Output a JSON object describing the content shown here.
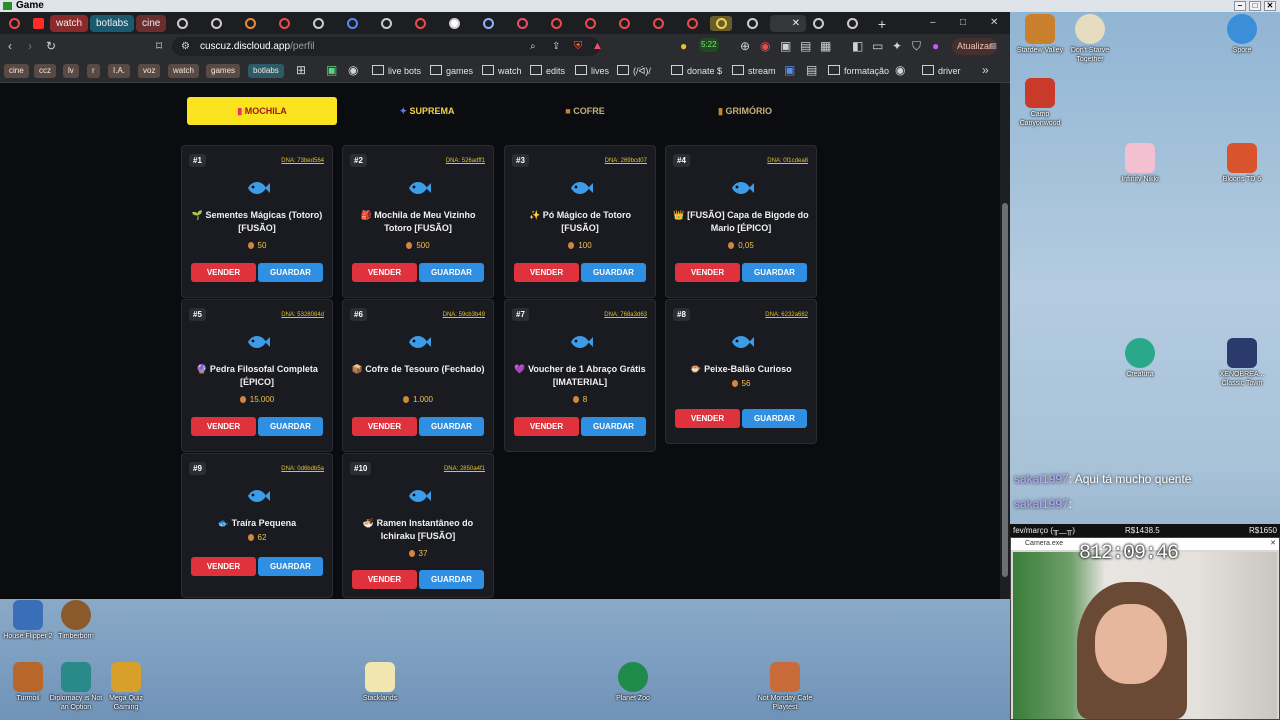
{
  "window": {
    "title": "Game"
  },
  "tabs": {
    "pinned": [
      "watch",
      "botlabs",
      "cine"
    ],
    "update_label": "Atualizar",
    "close_symbol": "✕",
    "new_tab_symbol": "+"
  },
  "address": {
    "host": "cuscuz.discloud.app",
    "path": "/perfil",
    "counter": "5:22"
  },
  "bookmarks": {
    "tags": [
      "cine",
      "ccz",
      "lv",
      "r",
      "I.A.",
      "voz",
      "watch",
      "games",
      "botlabs"
    ],
    "folders": [
      "live bots",
      "games",
      "watch",
      "edits",
      "lives",
      "(/ᐛ)/",
      "donate $",
      "stream",
      "formatação",
      "driver"
    ],
    "more": "»"
  },
  "inventory": {
    "tabs": [
      {
        "label": "MOCHILA",
        "icon": "bag-icon",
        "active": true
      },
      {
        "label": "SUPREMA",
        "icon": "star-icon",
        "active": false
      },
      {
        "label": "COFRE",
        "icon": "chest-icon",
        "active": false
      },
      {
        "label": "GRIMÓRIO",
        "icon": "book-icon",
        "active": false
      }
    ],
    "sell_label": "VENDER",
    "save_label": "GUARDAR",
    "items": [
      {
        "num": "#1",
        "dna": "DNA: 73bed564",
        "emoji": "🌱",
        "name": "Sementes Mágicas (Totoro) [FUSÃO]",
        "price": "50"
      },
      {
        "num": "#2",
        "dna": "DNA: 526adff1",
        "emoji": "🎒",
        "name": "Mochila de Meu Vizinho Totoro [FUSÃO]",
        "price": "500"
      },
      {
        "num": "#3",
        "dna": "DNA: 269bcd07",
        "emoji": "✨",
        "name": "Pó Mágico de Totoro [FUSÃO]",
        "price": "100"
      },
      {
        "num": "#4",
        "dna": "DNA: 0f1cdea8",
        "emoji": "👑",
        "name": "[FUSÃO] Capa de Bigode do Mario [ÉPICO]",
        "price": "0,05"
      },
      {
        "num": "#5",
        "dna": "DNA: 5328084d",
        "emoji": "🔮",
        "name": "Pedra Filosofal Completa [ÉPICO]",
        "price": "15.000"
      },
      {
        "num": "#6",
        "dna": "DNA: 59cb3b49",
        "emoji": "📦",
        "name": "Cofre de Tesouro (Fechado)",
        "price": "1.000"
      },
      {
        "num": "#7",
        "dna": "DNA: 768a3d63",
        "emoji": "💜",
        "name": "Voucher de 1 Abraço Grátis [IMATERIAL]",
        "price": "8"
      },
      {
        "num": "#8",
        "dna": "DNA: 6232a682",
        "emoji": "🐡",
        "name": "Peixe-Balão Curioso",
        "price": "56"
      },
      {
        "num": "#9",
        "dna": "DNA: 0d6bdb5a",
        "emoji": "🐟",
        "name": "Traíra Pequena",
        "price": "62"
      },
      {
        "num": "#10",
        "dna": "DNA: 2850a4f1",
        "emoji": "🍜",
        "name": "Ramen Instantâneo do Ichiraku [FUSÃO]",
        "price": "37"
      }
    ]
  },
  "desktop": {
    "icons_right": [
      "Stardew Valley",
      "Don't Starve Together",
      "Spore",
      "Camp Canyonwood",
      "Infinity Nikki",
      "Bloons TD 6",
      "Creatura",
      "XENOBREA... Classic Town"
    ],
    "icons_bottom": [
      "House Flipper 2",
      "Timberborn",
      "Turmoil",
      "Diplomacy is Not an Option",
      "Mega Quiz Gaming",
      "Stacklands",
      "Planet Zoo",
      "Not Monday Cafe Playtest"
    ]
  },
  "chat": [
    {
      "user": "sakai1997",
      "text": ": Aqui tá mucho quente"
    },
    {
      "user": "sakai1997",
      "text": ":"
    }
  ],
  "goal": {
    "label": "fev/março (╥﹏╥)",
    "current": "R$1438.5",
    "target": "R$1650"
  },
  "camera": {
    "title": "Camera.exe",
    "timer": "812:09:46"
  }
}
